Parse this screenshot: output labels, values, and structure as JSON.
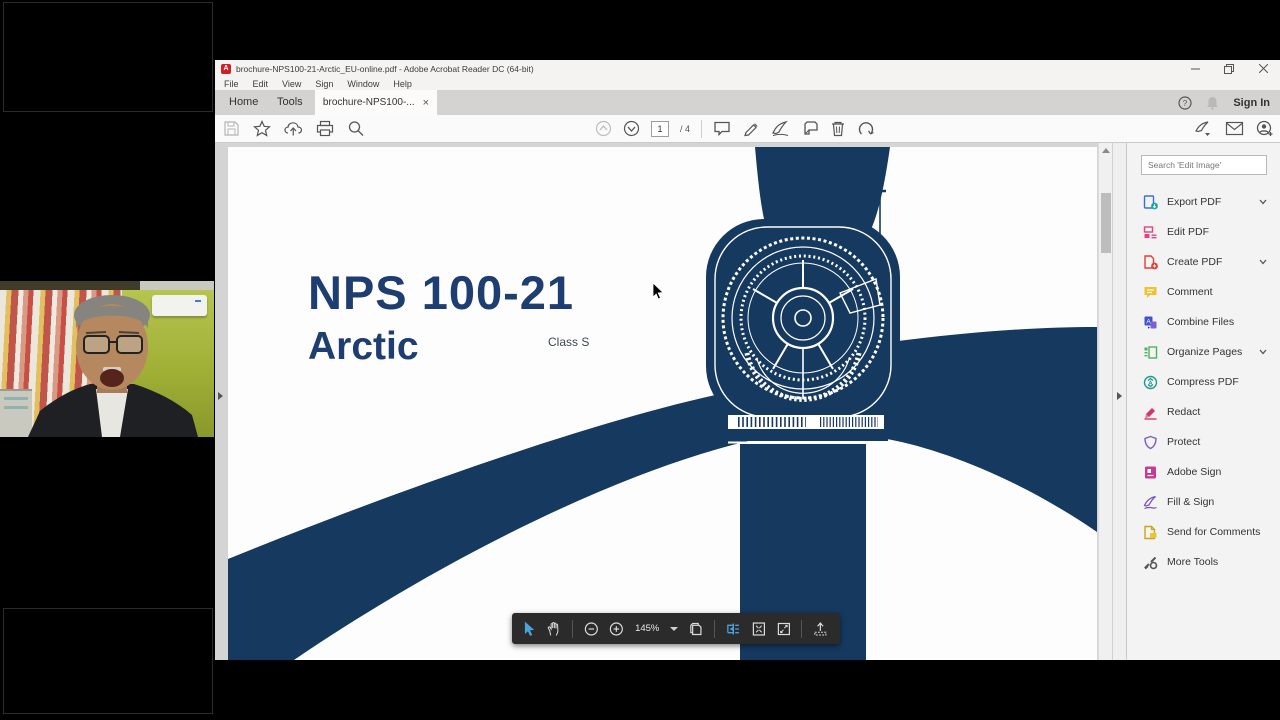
{
  "window": {
    "title": "brochure-NPS100-21-Arctic_EU-online.pdf - Adobe Acrobat Reader DC (64-bit)",
    "app_icon_letter": "A",
    "controls": [
      "minimize",
      "restore",
      "close"
    ]
  },
  "menu": {
    "items": [
      "File",
      "Edit",
      "View",
      "Sign",
      "Window",
      "Help"
    ]
  },
  "tabs": {
    "home": "Home",
    "tools": "Tools",
    "document": "brochure-NPS100-...",
    "close_glyph": "×"
  },
  "account": {
    "sign_in": "Sign In"
  },
  "toolbar_icons": [
    "save-icon",
    "star-icon",
    "cloud-upload-icon",
    "print-icon",
    "search-icon",
    "page-up-icon",
    "page-down-icon",
    "comment-icon",
    "highlight-icon",
    "sign-pen-icon",
    "stamp-icon",
    "trash-icon",
    "rotate-icon",
    "pen-tool-icon",
    "envelope-icon",
    "account-add-icon",
    "help-icon",
    "bell-icon"
  ],
  "pager": {
    "current": "1",
    "total": "/ 4"
  },
  "doc": {
    "title": "NPS 100-21",
    "subtitle": "Arctic",
    "class_label": "Class S"
  },
  "zoom_bar": {
    "level": "145%",
    "icons": [
      "cursor-icon",
      "hand-icon",
      "zoom-out-icon",
      "zoom-in-icon",
      "page-copy-icon",
      "scroll-mode-icon",
      "fit-page-icon",
      "fullscreen-icon",
      "share-upload-icon"
    ]
  },
  "tools_panel": {
    "search_placeholder": "Search 'Edit Image'",
    "items": [
      {
        "label": "Export PDF",
        "icon": "export-pdf-icon",
        "expandable": true
      },
      {
        "label": "Edit PDF",
        "icon": "edit-pdf-icon",
        "expandable": false
      },
      {
        "label": "Create PDF",
        "icon": "create-pdf-icon",
        "expandable": true
      },
      {
        "label": "Comment",
        "icon": "comment-icon",
        "expandable": false
      },
      {
        "label": "Combine Files",
        "icon": "combine-files-icon",
        "expandable": false
      },
      {
        "label": "Organize Pages",
        "icon": "organize-pages-icon",
        "expandable": true
      },
      {
        "label": "Compress PDF",
        "icon": "compress-pdf-icon",
        "expandable": false
      },
      {
        "label": "Redact",
        "icon": "redact-icon",
        "expandable": false
      },
      {
        "label": "Protect",
        "icon": "protect-icon",
        "expandable": false
      },
      {
        "label": "Adobe Sign",
        "icon": "adobe-sign-icon",
        "expandable": false
      },
      {
        "label": "Fill & Sign",
        "icon": "fill-sign-icon",
        "expandable": false
      },
      {
        "label": "Send for Comments",
        "icon": "send-comments-icon",
        "expandable": false
      },
      {
        "label": "More Tools",
        "icon": "more-tools-icon",
        "expandable": false
      }
    ]
  },
  "colors": {
    "turbine_navy": "#16395f",
    "title_blue": "#1e3d70",
    "accent_blue": "#3aa0dc"
  }
}
